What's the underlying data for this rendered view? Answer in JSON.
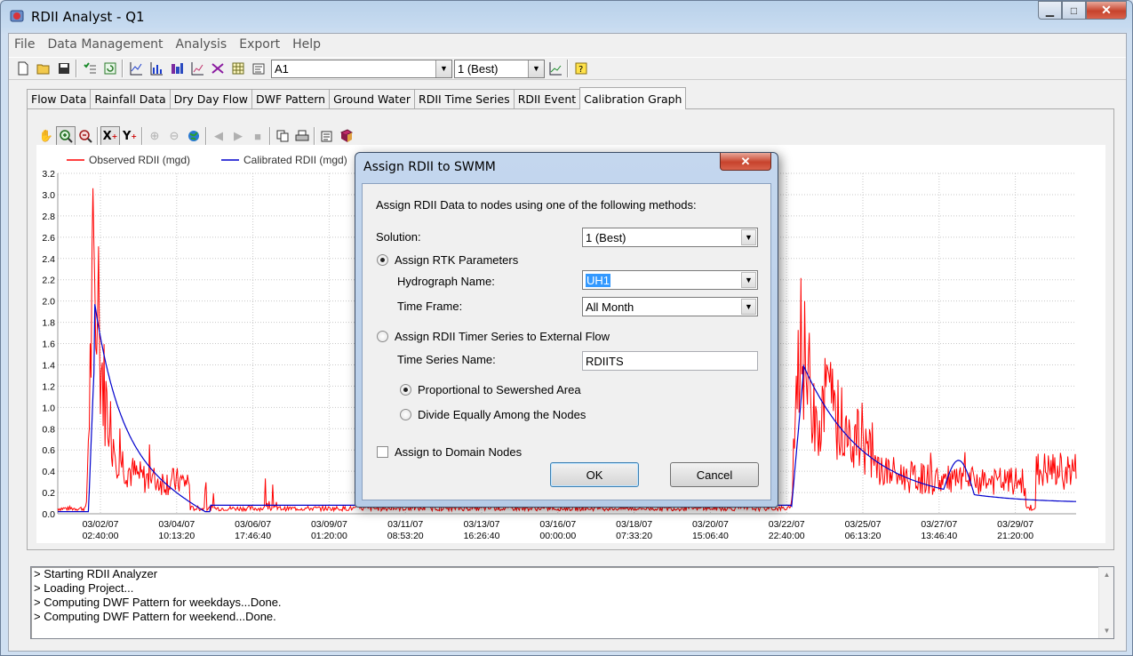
{
  "window": {
    "title": "RDII Analyst - Q1",
    "minimize": "▁",
    "maximize": "□",
    "close": "✕"
  },
  "menu": [
    "File",
    "Data Management",
    "Analysis",
    "Export",
    "Help"
  ],
  "toolbar": {
    "icons": [
      "new-file-icon",
      "open-folder-icon",
      "save-icon",
      "check-list-icon",
      "refresh-icon",
      "line-chart-icon",
      "bar-chart-icon",
      "bar-chart-alt-icon",
      "scatter-icon",
      "pattern-icon",
      "table-icon",
      "settings-icon"
    ],
    "location_value": "A1",
    "solution_value": "1 (Best)",
    "help_icon": "help-icon"
  },
  "tabs": [
    "Flow Data",
    "Rainfall Data",
    "Dry Day Flow",
    "DWF Pattern",
    "Ground Water",
    "RDII Time Series",
    "RDII Event",
    "Calibration Graph"
  ],
  "active_tab": "Calibration Graph",
  "chart_tools": [
    "pan-icon",
    "zoom-in-icon",
    "zoom-out-icon",
    "x-axis-icon",
    "y-axis-icon",
    "zoom-in-dim-icon",
    "zoom-out-dim-icon",
    "globe-icon",
    "prev-icon",
    "next-icon",
    "stop-icon",
    "copy-icon",
    "print-icon",
    "properties-icon",
    "book-icon"
  ],
  "chart_data": {
    "type": "line",
    "series": [
      {
        "name": "Observed RDII (mgd)",
        "color": "#ff0000"
      },
      {
        "name": "Calibrated RDII (mgd)",
        "color": "#0000cc"
      }
    ],
    "yticks": [
      "3.2",
      "3.0",
      "2.8",
      "2.6",
      "2.4",
      "2.2",
      "2.0",
      "1.8",
      "1.6",
      "1.4",
      "1.2",
      "1.0",
      "0.8",
      "0.6",
      "0.4",
      "0.2",
      "0.0"
    ],
    "ylim": [
      0,
      3.2
    ],
    "xticks": [
      [
        "03/02/07",
        "02:40:00"
      ],
      [
        "03/04/07",
        "10:13:20"
      ],
      [
        "03/06/07",
        "17:46:40"
      ],
      [
        "03/09/07",
        "01:20:00"
      ],
      [
        "03/11/07",
        "08:53:20"
      ],
      [
        "03/13/07",
        "16:26:40"
      ],
      [
        "03/16/07",
        "00:00:00"
      ],
      [
        "03/18/07",
        "07:33:20"
      ],
      [
        "03/20/07",
        "15:06:40"
      ],
      [
        "03/22/07",
        "22:40:00"
      ],
      [
        "03/25/07",
        "06:13:20"
      ],
      [
        "03/27/07",
        "13:46:40"
      ],
      [
        "03/29/07",
        "21:20:00"
      ]
    ],
    "grid": true,
    "legend": "top-left"
  },
  "dialog": {
    "title": "Assign RDII to SWMM",
    "close": "✕",
    "intro": "Assign RDII Data to nodes using one of the following methods:",
    "solution_label": "Solution:",
    "solution_value": "1 (Best)",
    "rtk_label": "Assign RTK Parameters",
    "hydrograph_label": "Hydrograph Name:",
    "hydrograph_value": "UH1",
    "timeframe_label": "Time Frame:",
    "timeframe_value": "All Month",
    "timeseries_option": "Assign RDII Timer Series to External Flow",
    "timeseries_name_label": "Time Series Name:",
    "timeseries_name_value": "RDIITS",
    "proportional_label": "Proportional to Sewershed Area",
    "divide_label": "Divide Equally Among the Nodes",
    "domain_label": "Assign to Domain Nodes",
    "ok": "OK",
    "cancel": "Cancel"
  },
  "log": [
    "> Starting RDII Analyzer",
    "> Loading Project...",
    "> Computing DWF Pattern for weekdays...Done.",
    "> Computing DWF Pattern for weekend...Done."
  ]
}
